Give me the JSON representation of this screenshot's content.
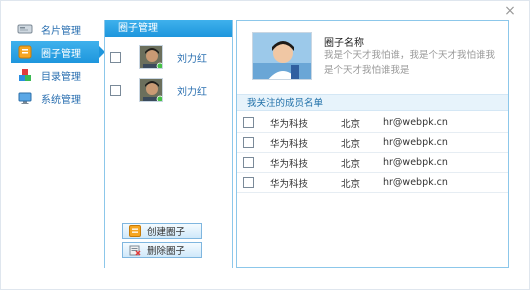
{
  "dialog": {
    "close_symbol": "×"
  },
  "nav": {
    "items": [
      {
        "label": "名片管理",
        "icon": "card-icon",
        "active": false
      },
      {
        "label": "圈子管理",
        "icon": "circle-icon",
        "active": true
      },
      {
        "label": "目录管理",
        "icon": "blocks-icon",
        "active": false
      },
      {
        "label": "系统管理",
        "icon": "monitor-icon",
        "active": false
      }
    ]
  },
  "circle_panel": {
    "title": "圈子管理",
    "members": [
      {
        "name": "刘力红"
      },
      {
        "name": "刘力红"
      }
    ],
    "buttons": {
      "create": "创建圈子",
      "delete": "删除圈子"
    }
  },
  "detail": {
    "circle_name": "圈子名称",
    "description": "我是个天才我怕谁，我是个天才我怕谁我是个天才我怕谁我是",
    "members_title": "我关注的成员名单",
    "members": [
      {
        "company": "华为科技",
        "city": "北京",
        "email": "hr@webpk.cn"
      },
      {
        "company": "华为科技",
        "city": "北京",
        "email": "hr@webpk.cn"
      },
      {
        "company": "华为科技",
        "city": "北京",
        "email": "hr@webpk.cn"
      },
      {
        "company": "华为科技",
        "city": "北京",
        "email": "hr@webpk.cn"
      }
    ]
  },
  "colors": {
    "accent": "#1e96dd",
    "link": "#2a6fb0",
    "border": "#8cc7ea",
    "header_bg": "#e7f3fb"
  }
}
